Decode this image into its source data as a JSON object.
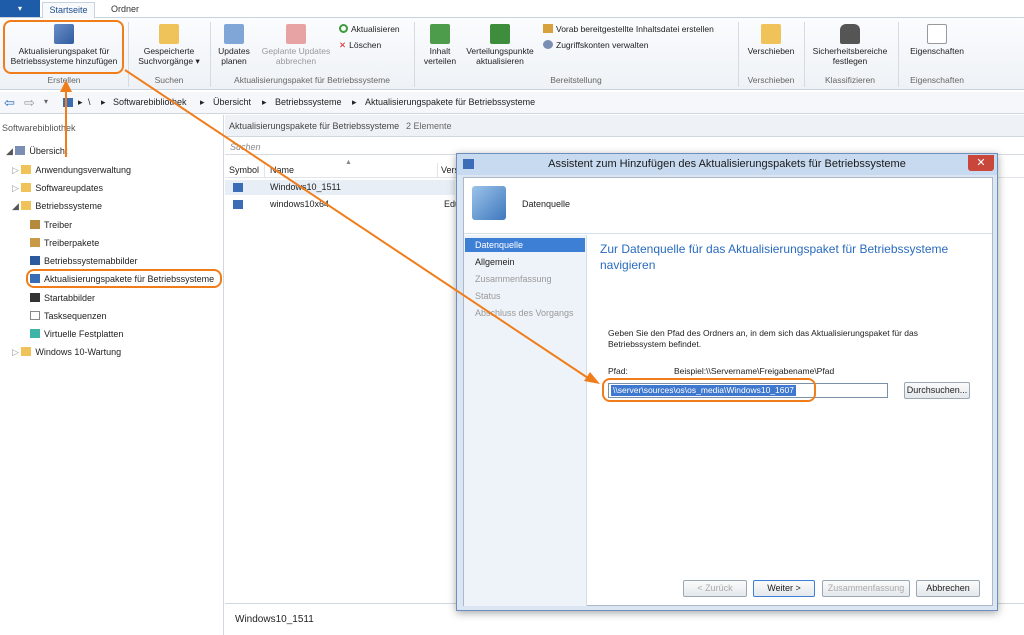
{
  "app": {
    "tabs": {
      "start": "Startseite",
      "ordner": "Ordner"
    }
  },
  "ribbon": {
    "add_pkg": "Aktualisierungspaket für Betriebssysteme hinzufügen",
    "saved_search": "Gespeicherte Suchvorgänge",
    "updates_plan": "Updates planen",
    "planned_cancel": "Geplante Updates abbrechen",
    "refresh": "Aktualisieren",
    "delete": "Löschen",
    "distribute": "Inhalt verteilen",
    "update_dp": "Verteilungspunkte aktualisieren",
    "prestaged": "Vorab bereitgestellte Inhaltsdatei erstellen",
    "access": "Zugriffskonten verwalten",
    "move": "Verschieben",
    "security": "Sicherheitsbereiche festlegen",
    "properties": "Eigenschaften",
    "groups": {
      "erstellen": "Erstellen",
      "suchen": "Suchen",
      "upd": "Aktualisierungspaket für Betriebssysteme",
      "bereit": "Bereitstellung",
      "versch": "Verschieben",
      "klass": "Klassifizieren",
      "eig": "Eigenschaften"
    }
  },
  "breadcrumb": [
    "\\",
    "Softwarebibliothek",
    "Übersicht",
    "Betriebssysteme",
    "Aktualisierungspakete für Betriebssysteme"
  ],
  "sidebar": {
    "title": "Softwarebibliothek",
    "items": [
      "Übersicht",
      "Anwendungsverwaltung",
      "Softwareupdates",
      "Betriebssysteme",
      "Treiber",
      "Treiberpakete",
      "Betriebssystemabbilder",
      "Aktualisierungspakete für Betriebssysteme",
      "Startabbilder",
      "Tasksequenzen",
      "Virtuelle Festplatten",
      "Windows 10-Wartung"
    ]
  },
  "list": {
    "heading": "Aktualisierungspakete für Betriebssysteme",
    "count": "2 Elemente",
    "search_placeholder": "Suchen",
    "columns": [
      "Symbol",
      "Name",
      "Vers"
    ],
    "rows": [
      {
        "name": "Windows10_1511",
        "ver": ""
      },
      {
        "name": "windows10x64",
        "ver": "Edu"
      }
    ],
    "details_title": "Windows10_1511"
  },
  "dialog": {
    "title": "Assistent zum Hinzufügen des Aktualisierungspakets für Betriebssysteme",
    "header": "Datenquelle",
    "steps": [
      "Datenquelle",
      "Allgemein",
      "Zusammenfassung",
      "Status",
      "Abschluss des Vorgangs"
    ],
    "heading": "Zur Datenquelle für das Aktualisierungspaket für Betriebssysteme navigieren",
    "instruction": "Geben Sie den Pfad des Ordners an, in dem sich das Aktualisierungspaket für das Betriebssystem befindet.",
    "path_label": "Pfad:",
    "example": "Beispiel:\\\\Servername\\Freigabename\\Pfad",
    "path_value": "\\\\server\\sources\\os\\os_media\\Windows10_1607",
    "browse": "Durchsuchen...",
    "back": "< Zurück",
    "next": "Weiter >",
    "summary": "Zusammenfassung",
    "cancel": "Abbrechen",
    "close": "✕"
  },
  "colors": {
    "accent": "#f07d1a",
    "brand": "#1e5ba8",
    "heading": "#2a6bbd"
  }
}
